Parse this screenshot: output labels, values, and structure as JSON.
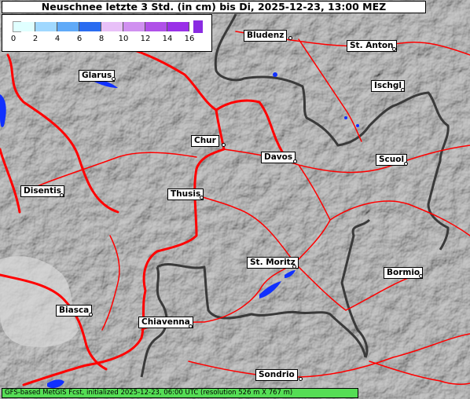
{
  "title": "Neuschnee letzte 3 Std. (in cm) bis Di, 2025-12-23, 13:00 MEZ",
  "legend": {
    "ticks": [
      "0",
      "2",
      "4",
      "6",
      "8",
      "10",
      "12",
      "14",
      "16"
    ],
    "colors": [
      "#e0ffff",
      "#a0d8ff",
      "#60aaf8",
      "#2a6cf0",
      "#e8c0f8",
      "#d090f0",
      "#b050e8",
      "#9a30e8"
    ],
    "under_color": "#9a9a9a",
    "over_color": "#8a2be2"
  },
  "cities": {
    "bludenz": "Bludenz",
    "st_anton": "St. Anton",
    "glarus": "Glarus",
    "ischgl": "Ischgl",
    "chur": "Chur",
    "davos": "Davos",
    "scuol": "Scuol",
    "disentis": "Disentis",
    "thusis": "Thusis",
    "st_moritz": "St. Moritz",
    "bormio": "Bormio",
    "biasca": "Biasca",
    "chiavenna": "Chiavenna",
    "sondrio": "Sondrio"
  },
  "footer": "GFS-based MetGIS Fcst, initialized 2025-12-23, 06:00 UTC  (resolution 526 m X 767 m)",
  "colors": {
    "terrain": "#8a8a8a",
    "road": "#ff0000",
    "border": "#3a3a3a",
    "lake": "#1030ff",
    "footer_bg": "#55dd55"
  }
}
